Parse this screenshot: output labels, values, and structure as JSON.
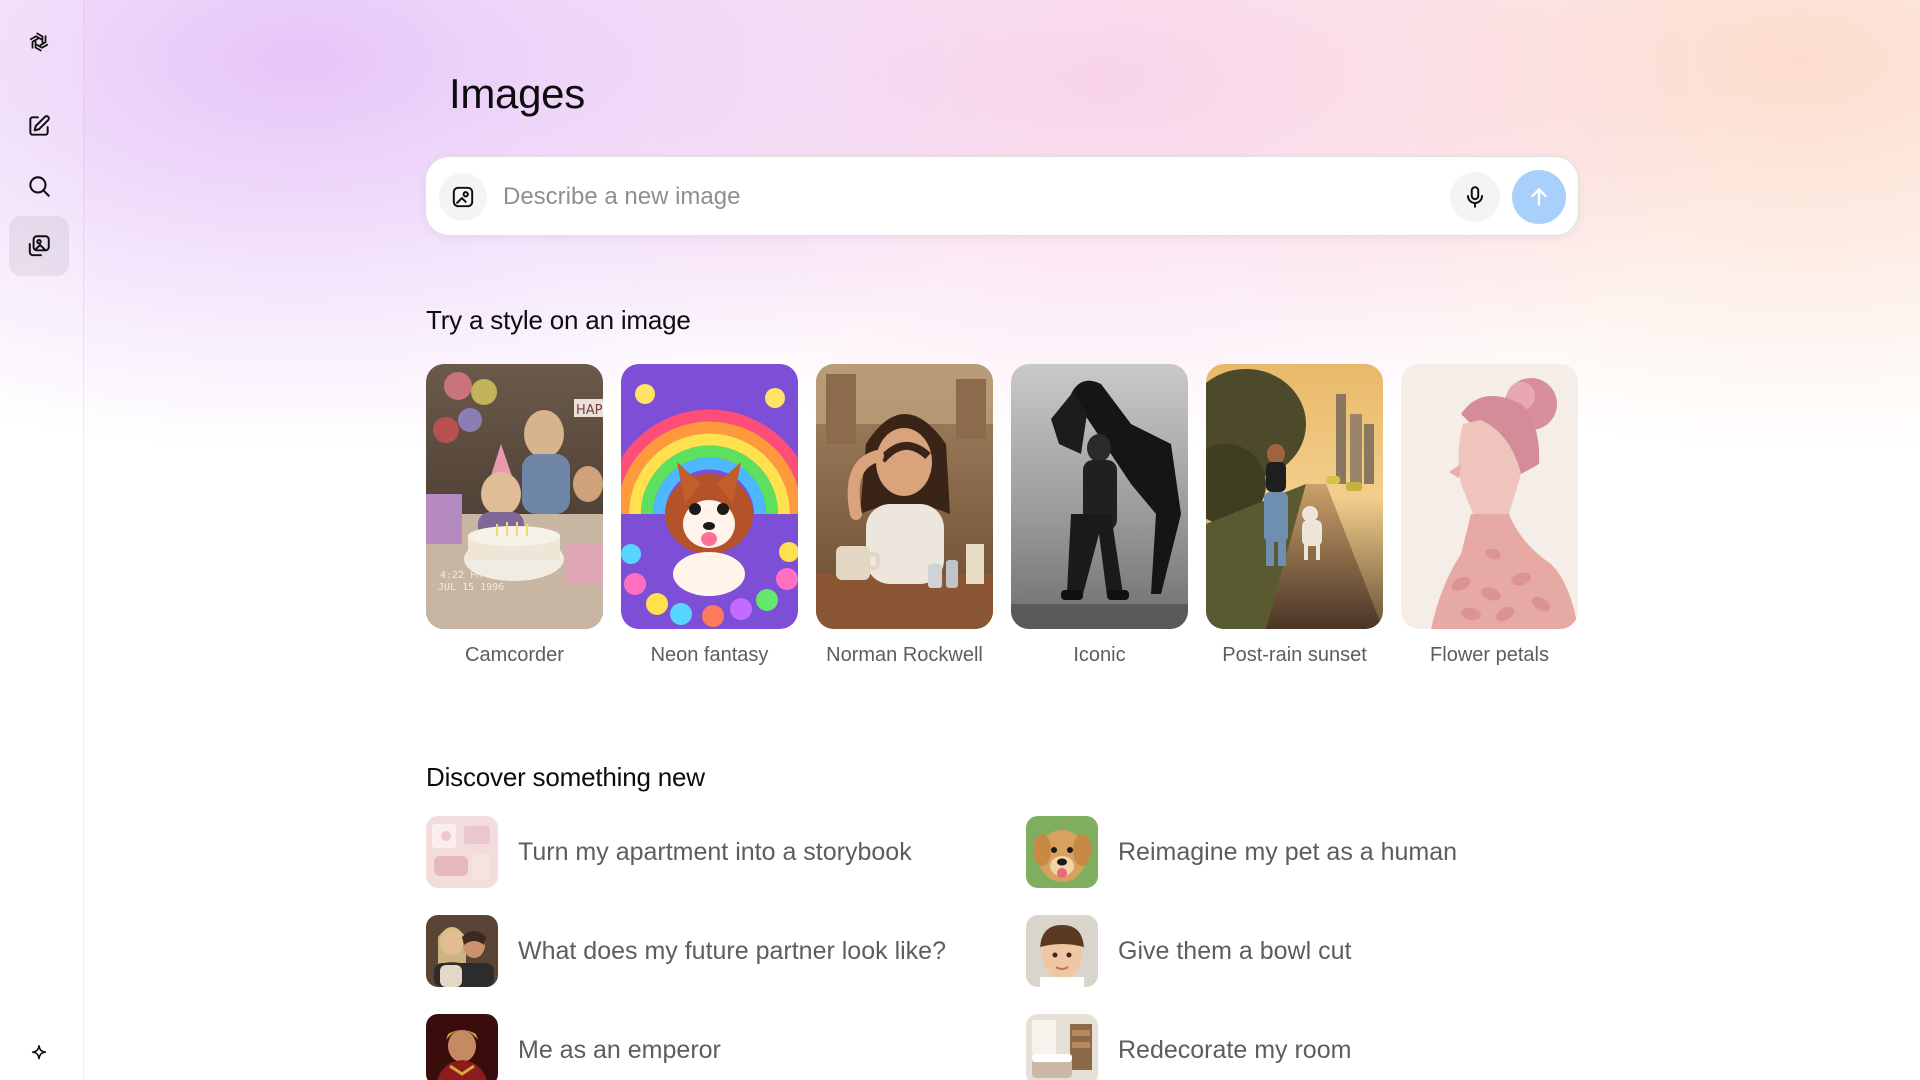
{
  "sidebar": {
    "items": [
      {
        "name": "openai-logo-icon"
      },
      {
        "name": "new-chat-icon"
      },
      {
        "name": "search-icon"
      },
      {
        "name": "images-icon",
        "active": true
      }
    ],
    "bottom": {
      "name": "sparkle-icon"
    }
  },
  "page": {
    "title": "Images"
  },
  "prompt": {
    "placeholder": "Describe a new image",
    "value": ""
  },
  "styles": {
    "heading": "Try a style on an image",
    "items": [
      {
        "label": "Camcorder",
        "overlay_line1": "4:22 PM",
        "overlay_line2": "JUL 15 1996",
        "sign_text": "HAPP"
      },
      {
        "label": "Neon fantasy"
      },
      {
        "label": "Norman Rockwell"
      },
      {
        "label": "Iconic"
      },
      {
        "label": "Post-rain sunset"
      },
      {
        "label": "Flower petals"
      }
    ]
  },
  "discover": {
    "heading": "Discover something new",
    "items": [
      {
        "label": "Turn my apartment into a storybook"
      },
      {
        "label": "Reimagine my pet as a human"
      },
      {
        "label": "What does my future partner look like?"
      },
      {
        "label": "Give them a bowl cut"
      },
      {
        "label": "Me as an emperor"
      },
      {
        "label": "Redecorate my room"
      }
    ]
  },
  "colors": {
    "send_button": "#a9cffb",
    "text_primary": "#0d0d0d",
    "text_secondary": "#5d5d5d",
    "placeholder": "#8f8f8f"
  }
}
